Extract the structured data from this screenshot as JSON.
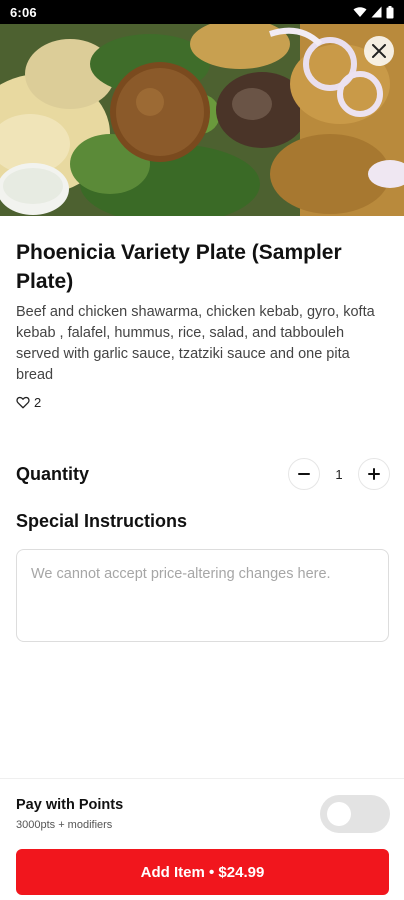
{
  "status_bar": {
    "time": "6:06",
    "icons": [
      "wifi-icon",
      "signal-icon",
      "battery-icon"
    ]
  },
  "hero": {
    "image": "falafel-shawarma-plate-photo",
    "close_icon": "close-icon"
  },
  "item": {
    "title": "Phoenicia Variety Plate (Sampler Plate)",
    "description": "Beef and chicken shawarma, chicken kebab, gyro, kofta kebab , falafel, hummus, rice, salad, and tabbouleh served with garlic sauce, tzatziki sauce and one pita bread",
    "likes": "2",
    "like_icon": "heart-outline-icon"
  },
  "quantity": {
    "label": "Quantity",
    "value": "1",
    "decrement_icon": "minus-icon",
    "increment_icon": "plus-icon"
  },
  "instructions": {
    "label": "Special Instructions",
    "placeholder": "We cannot accept price-altering changes here.",
    "value": ""
  },
  "footer": {
    "points_label": "Pay with Points",
    "points_sub": "3000pts + modifiers",
    "points_toggle_on": false,
    "add_button_label": "Add Item • $24.99"
  },
  "colors": {
    "accent": "#f1161d",
    "toggle_off": "#e3e3e3",
    "text_primary": "#111111",
    "text_secondary": "#444444",
    "placeholder": "#a6a6a6"
  }
}
